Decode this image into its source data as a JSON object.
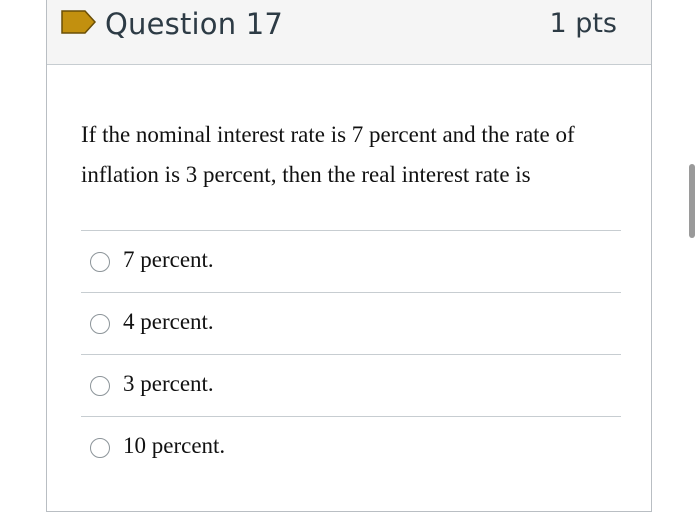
{
  "header": {
    "title": "Question 17",
    "points": "1 pts",
    "flag_icon": "flag-icon",
    "flag_color": "#c2900f"
  },
  "question": {
    "text": "If the nominal interest rate is 7 percent and the rate of inflation is 3 percent, then the real interest rate is"
  },
  "answers": [
    {
      "label": "7 percent.",
      "selected": false
    },
    {
      "label": "4 percent.",
      "selected": false
    },
    {
      "label": "3 percent.",
      "selected": false
    },
    {
      "label": "10 percent.",
      "selected": false
    }
  ]
}
